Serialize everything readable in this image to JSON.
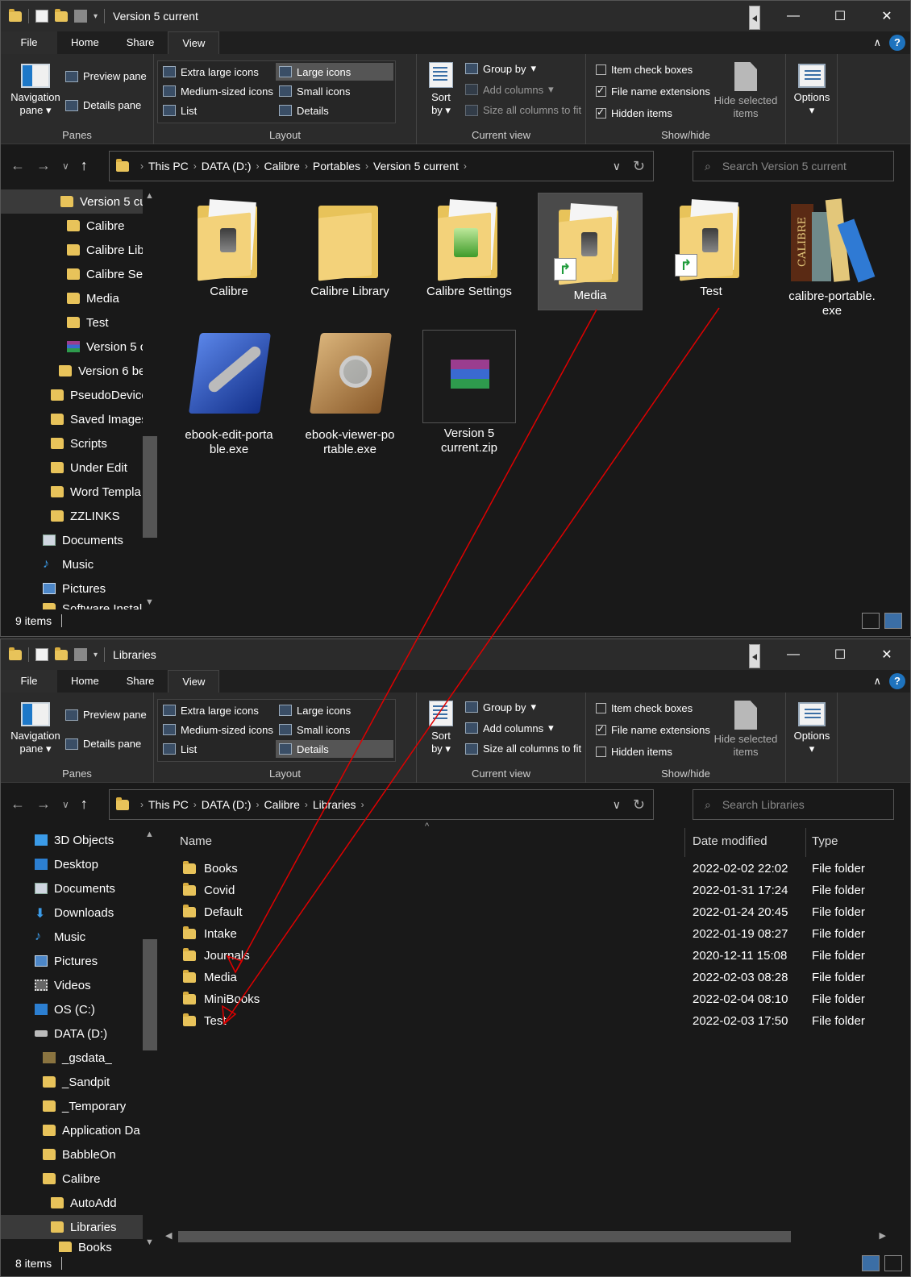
{
  "win1": {
    "title": "Version 5 current",
    "tabs": [
      "File",
      "Home",
      "Share",
      "View"
    ],
    "ribbon": {
      "panes": {
        "nav": "Navigation pane",
        "preview": "Preview pane",
        "details": "Details pane",
        "label": "Panes"
      },
      "layout": {
        "items": [
          "Extra large icons",
          "Large icons",
          "Medium-sized icons",
          "Small icons",
          "List",
          "Details"
        ],
        "selected": "Large icons",
        "label": "Layout"
      },
      "current_view": {
        "sort": "Sort by",
        "group": "Group by",
        "add_columns": "Add columns",
        "size_cols": "Size all columns to fit",
        "label": "Current view"
      },
      "show_hide": {
        "item_check": "Item check boxes",
        "file_ext": "File name extensions",
        "hidden": "Hidden items",
        "hide_selected": "Hide selected items",
        "label": "Show/hide",
        "item_check_on": false,
        "file_ext_on": true,
        "hidden_on": true
      },
      "options": "Options"
    },
    "address": [
      "This PC",
      "DATA (D:)",
      "Calibre",
      "Portables",
      "Version 5 current"
    ],
    "search_placeholder": "Search Version 5 current",
    "nav": [
      "Version 5 cu",
      "Calibre",
      "Calibre Lib",
      "Calibre Set",
      "Media",
      "Test",
      "Version 5 c",
      "Version 6 be",
      "PseudoDevice",
      "Saved Images",
      "Scripts",
      "Under Edit",
      "Word Templa",
      "ZZLINKS",
      "Documents",
      "Music",
      "Pictures",
      "Software Instal"
    ],
    "items": [
      "Calibre",
      "Calibre Library",
      "Calibre Settings",
      "Media",
      "Test",
      "calibre-portable.exe",
      "ebook-edit-portable.exe",
      "ebook-viewer-portable.exe",
      "Version 5 current.zip"
    ],
    "item_labels": {
      "i6a": "calibre-portable.",
      "i6b": "exe",
      "i7a": "ebook-edit-porta",
      "i7b": "ble.exe",
      "i8a": "ebook-viewer-po",
      "i8b": "rtable.exe",
      "i9a": "Version 5",
      "i9b": "current.zip"
    },
    "status": "9 items"
  },
  "win2": {
    "title": "Libraries",
    "tabs": [
      "File",
      "Home",
      "Share",
      "View"
    ],
    "ribbon": {
      "layout_selected": "Details",
      "show_hide": {
        "item_check_on": false,
        "file_ext_on": true,
        "hidden_on": false
      }
    },
    "address": [
      "This PC",
      "DATA (D:)",
      "Calibre",
      "Libraries"
    ],
    "search_placeholder": "Search Libraries",
    "nav": [
      "3D Objects",
      "Desktop",
      "Documents",
      "Downloads",
      "Music",
      "Pictures",
      "Videos",
      "OS (C:)",
      "DATA (D:)",
      "_gsdata_",
      "_Sandpit",
      "_Temporary",
      "Application Da",
      "BabbleOn",
      "Calibre",
      "AutoAdd",
      "Libraries",
      "Books"
    ],
    "columns": [
      "Name",
      "Date modified",
      "Type"
    ],
    "rows": [
      {
        "name": "Books",
        "date": "2022-02-02 22:02",
        "type": "File folder"
      },
      {
        "name": "Covid",
        "date": "2022-01-31 17:24",
        "type": "File folder"
      },
      {
        "name": "Default",
        "date": "2022-01-24 20:45",
        "type": "File folder"
      },
      {
        "name": "Intake",
        "date": "2022-01-19 08:27",
        "type": "File folder"
      },
      {
        "name": "Journals",
        "date": "2020-12-11 15:08",
        "type": "File folder"
      },
      {
        "name": "Media",
        "date": "2022-02-03 08:28",
        "type": "File folder"
      },
      {
        "name": "MiniBooks",
        "date": "2022-02-04 08:10",
        "type": "File folder"
      },
      {
        "name": "Test",
        "date": "2022-02-03 17:50",
        "type": "File folder"
      }
    ],
    "status": "8 items"
  },
  "colors": {
    "accent": "#1e73be",
    "folder": "#e8c35a",
    "arrow": "#e00000"
  }
}
